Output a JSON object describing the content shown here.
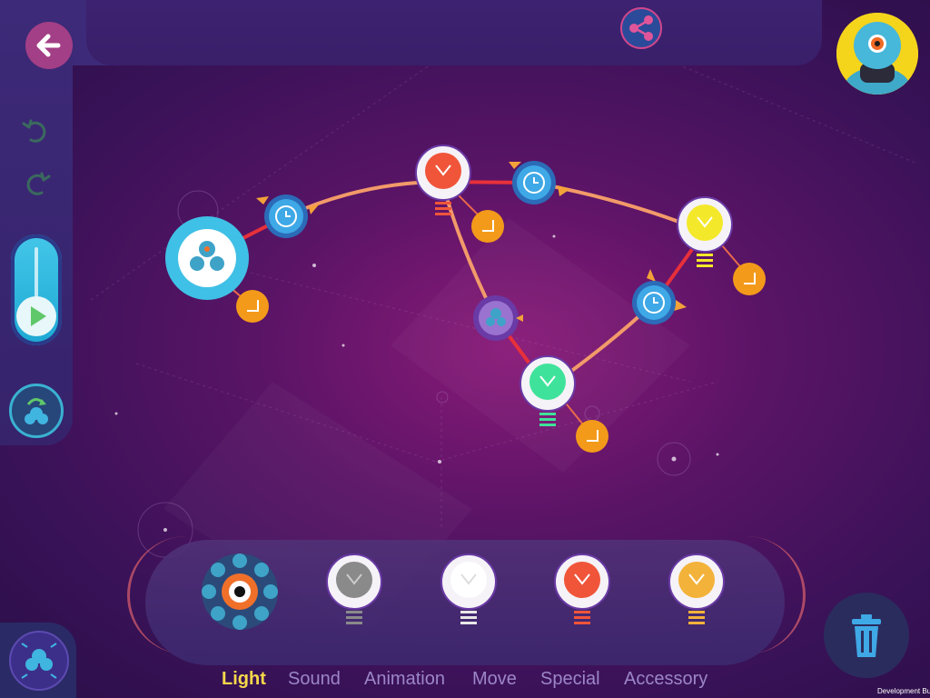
{
  "toolbar": {
    "back_icon": "arrow-left-icon",
    "share_icon": "share-nodes-icon",
    "avatar_icon": "dash-robot-avatar-icon"
  },
  "sidebar": {
    "undo_icon": "undo-icon",
    "redo_icon": "redo-icon",
    "play_icon": "play-icon",
    "robot_switch_icon": "robot-switch-icon",
    "robot_select_icon": "robot-select-icon"
  },
  "palette": {
    "items": [
      {
        "name": "eye-ring",
        "icon": "eye-light-icon"
      },
      {
        "name": "light-gray",
        "color": "#8a8a8a"
      },
      {
        "name": "light-white",
        "color": "#f4f4f4"
      },
      {
        "name": "light-red",
        "color": "#f0553a"
      },
      {
        "name": "light-orange",
        "color": "#f3b23a"
      }
    ]
  },
  "tabs": [
    {
      "label": "Light",
      "active": true
    },
    {
      "label": "Sound",
      "active": false
    },
    {
      "label": "Animation",
      "active": false
    },
    {
      "label": "Move",
      "active": false
    },
    {
      "label": "Special",
      "active": false
    },
    {
      "label": "Accessory",
      "active": false
    }
  ],
  "trash_icon": "trash-icon",
  "footer": {
    "dev_build": "Development Build"
  },
  "colors": {
    "accent_cyan": "#3fc0e6",
    "accent_red": "#e8303a",
    "accent_orange": "#f29a28",
    "active_tab": "#f7d84a"
  }
}
